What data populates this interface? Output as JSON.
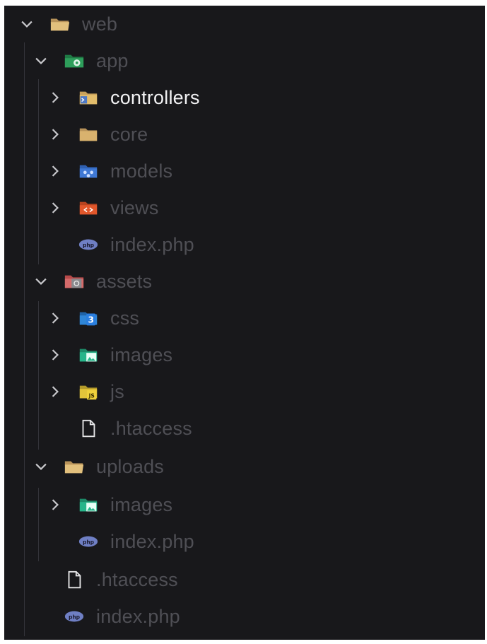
{
  "explorer": {
    "root": {
      "label": "web",
      "icon": "folder-open-icon"
    },
    "app": {
      "label": "app",
      "icon": "app-folder-icon",
      "children": {
        "controllers": {
          "label": "controllers",
          "icon": "controllers-folder-icon"
        },
        "core": {
          "label": "core",
          "icon": "folder-icon"
        },
        "models": {
          "label": "models",
          "icon": "models-folder-icon"
        },
        "views": {
          "label": "views",
          "icon": "views-folder-icon"
        },
        "index": {
          "label": "index.php",
          "icon": "php-file-icon"
        }
      }
    },
    "assets": {
      "label": "assets",
      "icon": "assets-folder-icon",
      "children": {
        "css": {
          "label": "css",
          "icon": "css-folder-icon"
        },
        "images": {
          "label": "images",
          "icon": "images-folder-icon"
        },
        "js": {
          "label": "js",
          "icon": "js-folder-icon"
        },
        "htaccess": {
          "label": ".htaccess",
          "icon": "file-icon"
        }
      }
    },
    "uploads": {
      "label": "uploads",
      "icon": "folder-open-icon",
      "children": {
        "images": {
          "label": "images",
          "icon": "images-folder-icon"
        },
        "index": {
          "label": "index.php",
          "icon": "php-file-icon"
        }
      }
    },
    "htaccess": {
      "label": ".htaccess",
      "icon": "file-icon"
    },
    "index": {
      "label": "index.php",
      "icon": "php-file-icon"
    }
  },
  "colors": {
    "background": "#18181b",
    "text_dim": "#4f4f55",
    "text_active": "#f1f1f3",
    "folder": "#d9b26e",
    "app_green": "#2e9e5b",
    "css_blue": "#2f86d8",
    "images_teal": "#27b58a",
    "js_yellow": "#e3c53a",
    "views_orange": "#e2572b",
    "php_blue": "#6f7fc4"
  }
}
